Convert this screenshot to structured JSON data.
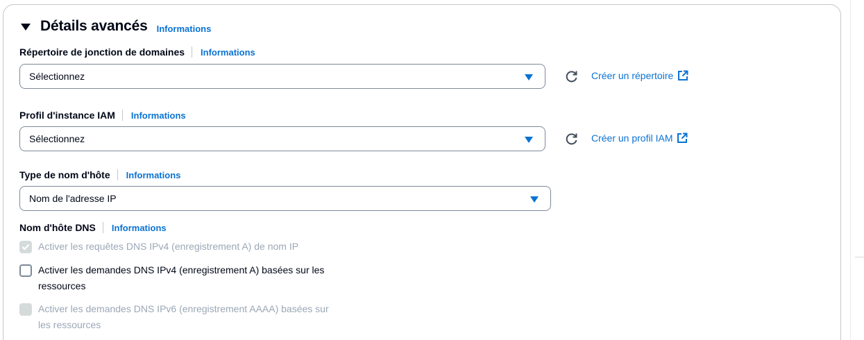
{
  "section": {
    "title": "Détails avancés",
    "info_label": "Informations"
  },
  "domain_join": {
    "label": "Répertoire de jonction de domaines",
    "info_label": "Informations",
    "value": "Sélectionnez",
    "create_link": "Créer un répertoire"
  },
  "iam_profile": {
    "label": "Profil d'instance IAM",
    "info_label": "Informations",
    "value": "Sélectionnez",
    "create_link": "Créer un profil IAM"
  },
  "hostname_type": {
    "label": "Type de nom d'hôte",
    "info_label": "Informations",
    "value": "Nom de l'adresse IP"
  },
  "dns_hostname": {
    "label": "Nom d'hôte DNS",
    "info_label": "Informations",
    "options": [
      {
        "line1": "Activer les requêtes DNS IPv4 (enregistrement A) de nom IP",
        "line2": "",
        "checked": true,
        "disabled": true
      },
      {
        "line1": "Activer les demandes DNS IPv4 (enregistrement A) basées sur les",
        "line2": "ressources",
        "checked": false,
        "disabled": false
      },
      {
        "line1": "Activer les demandes DNS IPv6 (enregistrement AAAA) basées sur",
        "line2": "les ressources",
        "checked": false,
        "disabled": true
      }
    ]
  },
  "colors": {
    "link": "#0972d3",
    "text": "#000716",
    "disabled_text": "#9ba7b6",
    "border": "#7d8998"
  }
}
